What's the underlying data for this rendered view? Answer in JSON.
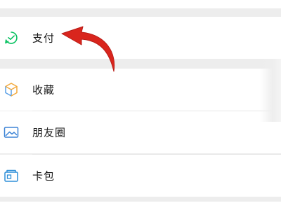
{
  "menu": {
    "items": [
      {
        "label": "支付",
        "icon": "pay-icon"
      },
      {
        "label": "收藏",
        "icon": "favorites-cube-icon"
      },
      {
        "label": "朋友圈",
        "icon": "moments-image-icon"
      },
      {
        "label": "卡包",
        "icon": "card-wallet-icon"
      }
    ]
  },
  "colors": {
    "pay_icon": "#07c160",
    "favorites_icon": "#f3a93b",
    "favorites_icon_secondary": "#5aa0e6",
    "moments_icon": "#3d84d6",
    "cards_icon": "#2f8fd8",
    "annotation_arrow": "#d9251d"
  }
}
